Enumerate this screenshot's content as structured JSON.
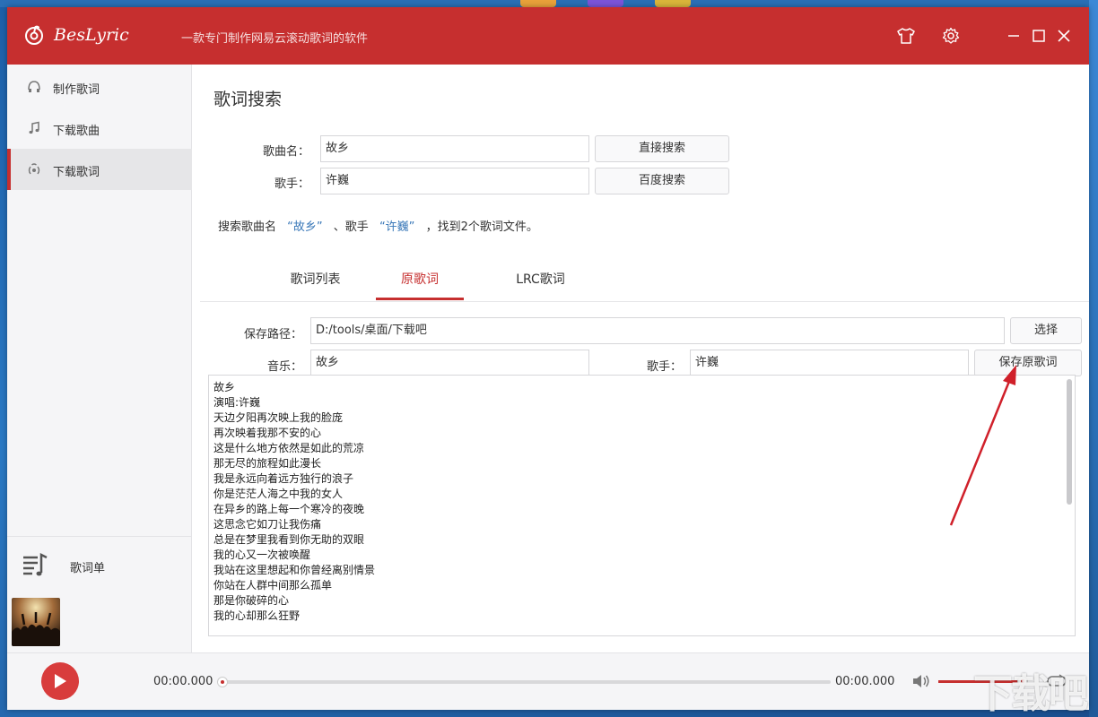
{
  "window": {
    "app_name": "BesLyric",
    "subtitle": "一款专门制作网易云滚动歌词的软件"
  },
  "sidebar": {
    "items": [
      {
        "label": "制作歌词",
        "icon": "headphones-icon"
      },
      {
        "label": "下载歌曲",
        "icon": "music-note-icon"
      },
      {
        "label": "下载歌词",
        "icon": "radio-icon"
      }
    ],
    "active_index": 2,
    "playlist_label": "歌词单"
  },
  "search": {
    "title": "歌词搜索",
    "song_label": "歌曲名：",
    "song_value": "故乡",
    "artist_label": "歌手：",
    "artist_value": "许巍",
    "direct_search_label": "直接搜索",
    "baidu_search_label": "百度搜索",
    "result_prefix": "搜索歌曲名",
    "result_song": "“故乡”",
    "result_mid": "、歌手",
    "result_artist": "“许巍”",
    "result_suffix": "，找到2个歌词文件。"
  },
  "tabs": [
    {
      "label": "歌词列表"
    },
    {
      "label": "原歌词"
    },
    {
      "label": "LRC歌词"
    }
  ],
  "active_tab": 1,
  "save": {
    "path_label": "保存路径：",
    "path_value": "D:/tools/桌面/下载吧",
    "choose_label": "选择",
    "music_label": "音乐：",
    "music_value": "故乡",
    "artist_label": "歌手：",
    "artist_value": "许巍",
    "save_button_label": "保存原歌词"
  },
  "lyrics": [
    "故乡",
    "演唱:许巍",
    "天边夕阳再次映上我的脸庞",
    "再次映着我那不安的心",
    "这是什么地方依然是如此的荒凉",
    "那无尽的旅程如此漫长",
    "我是永远向着远方独行的浪子",
    "你是茫茫人海之中我的女人",
    "在异乡的路上每一个寒冷的夜晚",
    "这思念它如刀让我伤痛",
    "总是在梦里我看到你无助的双眼",
    "我的心又一次被唤醒",
    "我站在这里想起和你曾经离别情景",
    "你站在人群中间那么孤单",
    "那是你破碎的心",
    "我的心却那么狂野"
  ],
  "player": {
    "current_time": "00:00.000",
    "total_time": "00:00.000",
    "progress": 0,
    "volume": 0.98
  },
  "watermark": "下载吧",
  "colors": {
    "brand_red": "#c62f2f",
    "link_blue": "#3a78b8"
  }
}
